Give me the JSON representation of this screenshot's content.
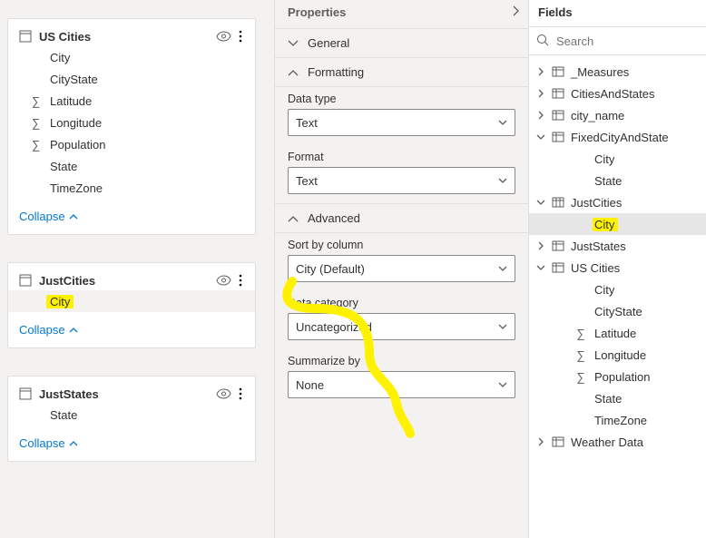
{
  "left": {
    "cards": [
      {
        "id": "us-cities",
        "title": "US Cities",
        "fields": [
          {
            "label": "City",
            "sigma": false
          },
          {
            "label": "CityState",
            "sigma": false
          },
          {
            "label": "Latitude",
            "sigma": true
          },
          {
            "label": "Longitude",
            "sigma": true
          },
          {
            "label": "Population",
            "sigma": true
          },
          {
            "label": "State",
            "sigma": false
          },
          {
            "label": "TimeZone",
            "sigma": false
          }
        ],
        "collapse": "Collapse"
      },
      {
        "id": "just-cities",
        "title": "JustCities",
        "fields": [
          {
            "label": "City",
            "sigma": false,
            "selected": true,
            "highlight": true
          }
        ],
        "collapse": "Collapse"
      },
      {
        "id": "just-states",
        "title": "JustStates",
        "fields": [
          {
            "label": "State",
            "sigma": false
          }
        ],
        "collapse": "Collapse"
      }
    ]
  },
  "properties": {
    "header": "Properties",
    "sections": {
      "general": "General",
      "formatting": "Formatting",
      "advanced": "Advanced"
    },
    "formatting": {
      "dataTypeLabel": "Data type",
      "dataTypeValue": "Text",
      "formatLabel": "Format",
      "formatValue": "Text"
    },
    "advanced": {
      "sortByLabel": "Sort by column",
      "sortByValue": "City (Default)",
      "dataCategoryLabel": "Data category",
      "dataCategoryValue": "Uncategorized",
      "summarizeLabel": "Summarize by",
      "summarizeValue": "None"
    }
  },
  "fields": {
    "header": "Fields",
    "searchPlaceholder": "Search",
    "tree": [
      {
        "depth": 1,
        "twisty": "right",
        "icon": "table",
        "label": "_Measures"
      },
      {
        "depth": 1,
        "twisty": "right",
        "icon": "table",
        "label": "CitiesAndStates"
      },
      {
        "depth": 1,
        "twisty": "right",
        "icon": "table",
        "label": "city_name"
      },
      {
        "depth": 1,
        "twisty": "down",
        "icon": "table",
        "label": "FixedCityAndState"
      },
      {
        "depth": 2,
        "icon": "",
        "label": "City"
      },
      {
        "depth": 2,
        "icon": "",
        "label": "State"
      },
      {
        "depth": 1,
        "twisty": "down",
        "icon": "qtable",
        "label": "JustCities"
      },
      {
        "depth": 2,
        "icon": "",
        "label": "City",
        "selected": true,
        "highlight": true
      },
      {
        "depth": 1,
        "twisty": "right",
        "icon": "table",
        "label": "JustStates"
      },
      {
        "depth": 1,
        "twisty": "down",
        "icon": "table",
        "label": "US Cities"
      },
      {
        "depth": 2,
        "icon": "",
        "label": "City"
      },
      {
        "depth": 2,
        "icon": "",
        "label": "CityState"
      },
      {
        "depth": 2,
        "icon": "sigma",
        "label": "Latitude"
      },
      {
        "depth": 2,
        "icon": "sigma",
        "label": "Longitude"
      },
      {
        "depth": 2,
        "icon": "sigma",
        "label": "Population"
      },
      {
        "depth": 2,
        "icon": "",
        "label": "State"
      },
      {
        "depth": 2,
        "icon": "",
        "label": "TimeZone"
      },
      {
        "depth": 1,
        "twisty": "right",
        "icon": "table",
        "label": "Weather Data"
      }
    ]
  }
}
